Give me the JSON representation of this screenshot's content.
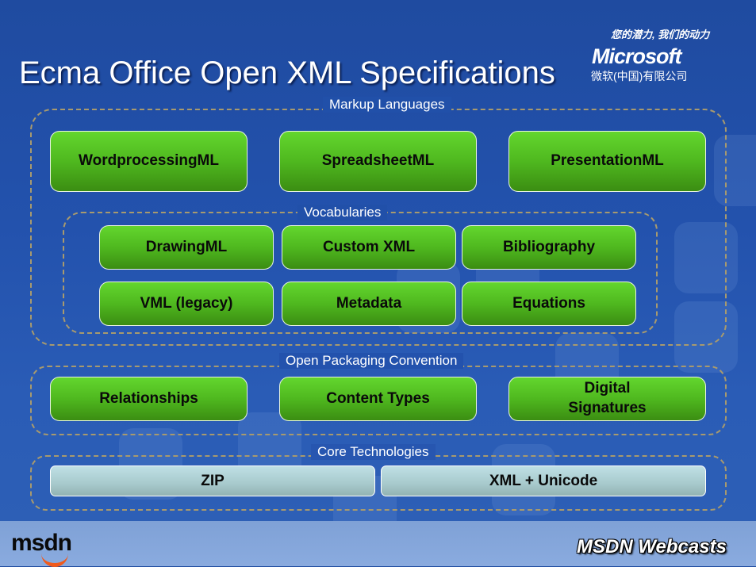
{
  "slide": {
    "title": "Ecma Office Open XML Specifications",
    "branding": {
      "slogan": "您的潜力, 我们的动力",
      "company_logo": "Microsoft",
      "company_sub": "微软(中国)有限公司",
      "footer_logo": "msdn",
      "footer_text": "MSDN Webcasts"
    },
    "colors": {
      "background": "#2352ad",
      "green_box": "#4fb81f",
      "core_box": "#a7c9cc",
      "dashed_border": "#a89a6e"
    },
    "groups": {
      "markup": {
        "label": "Markup Languages",
        "items": [
          "WordprocessingML",
          "SpreadsheetML",
          "PresentationML"
        ]
      },
      "vocabularies": {
        "label": "Vocabularies",
        "items": [
          "DrawingML",
          "Custom XML",
          "Bibliography",
          "VML (legacy)",
          "Metadata",
          "Equations"
        ]
      },
      "opc": {
        "label": "Open Packaging Convention",
        "items": [
          "Relationships",
          "Content Types",
          "Digital Signatures"
        ]
      },
      "core": {
        "label": "Core Technologies",
        "items": [
          "ZIP",
          "XML + Unicode"
        ]
      }
    }
  }
}
